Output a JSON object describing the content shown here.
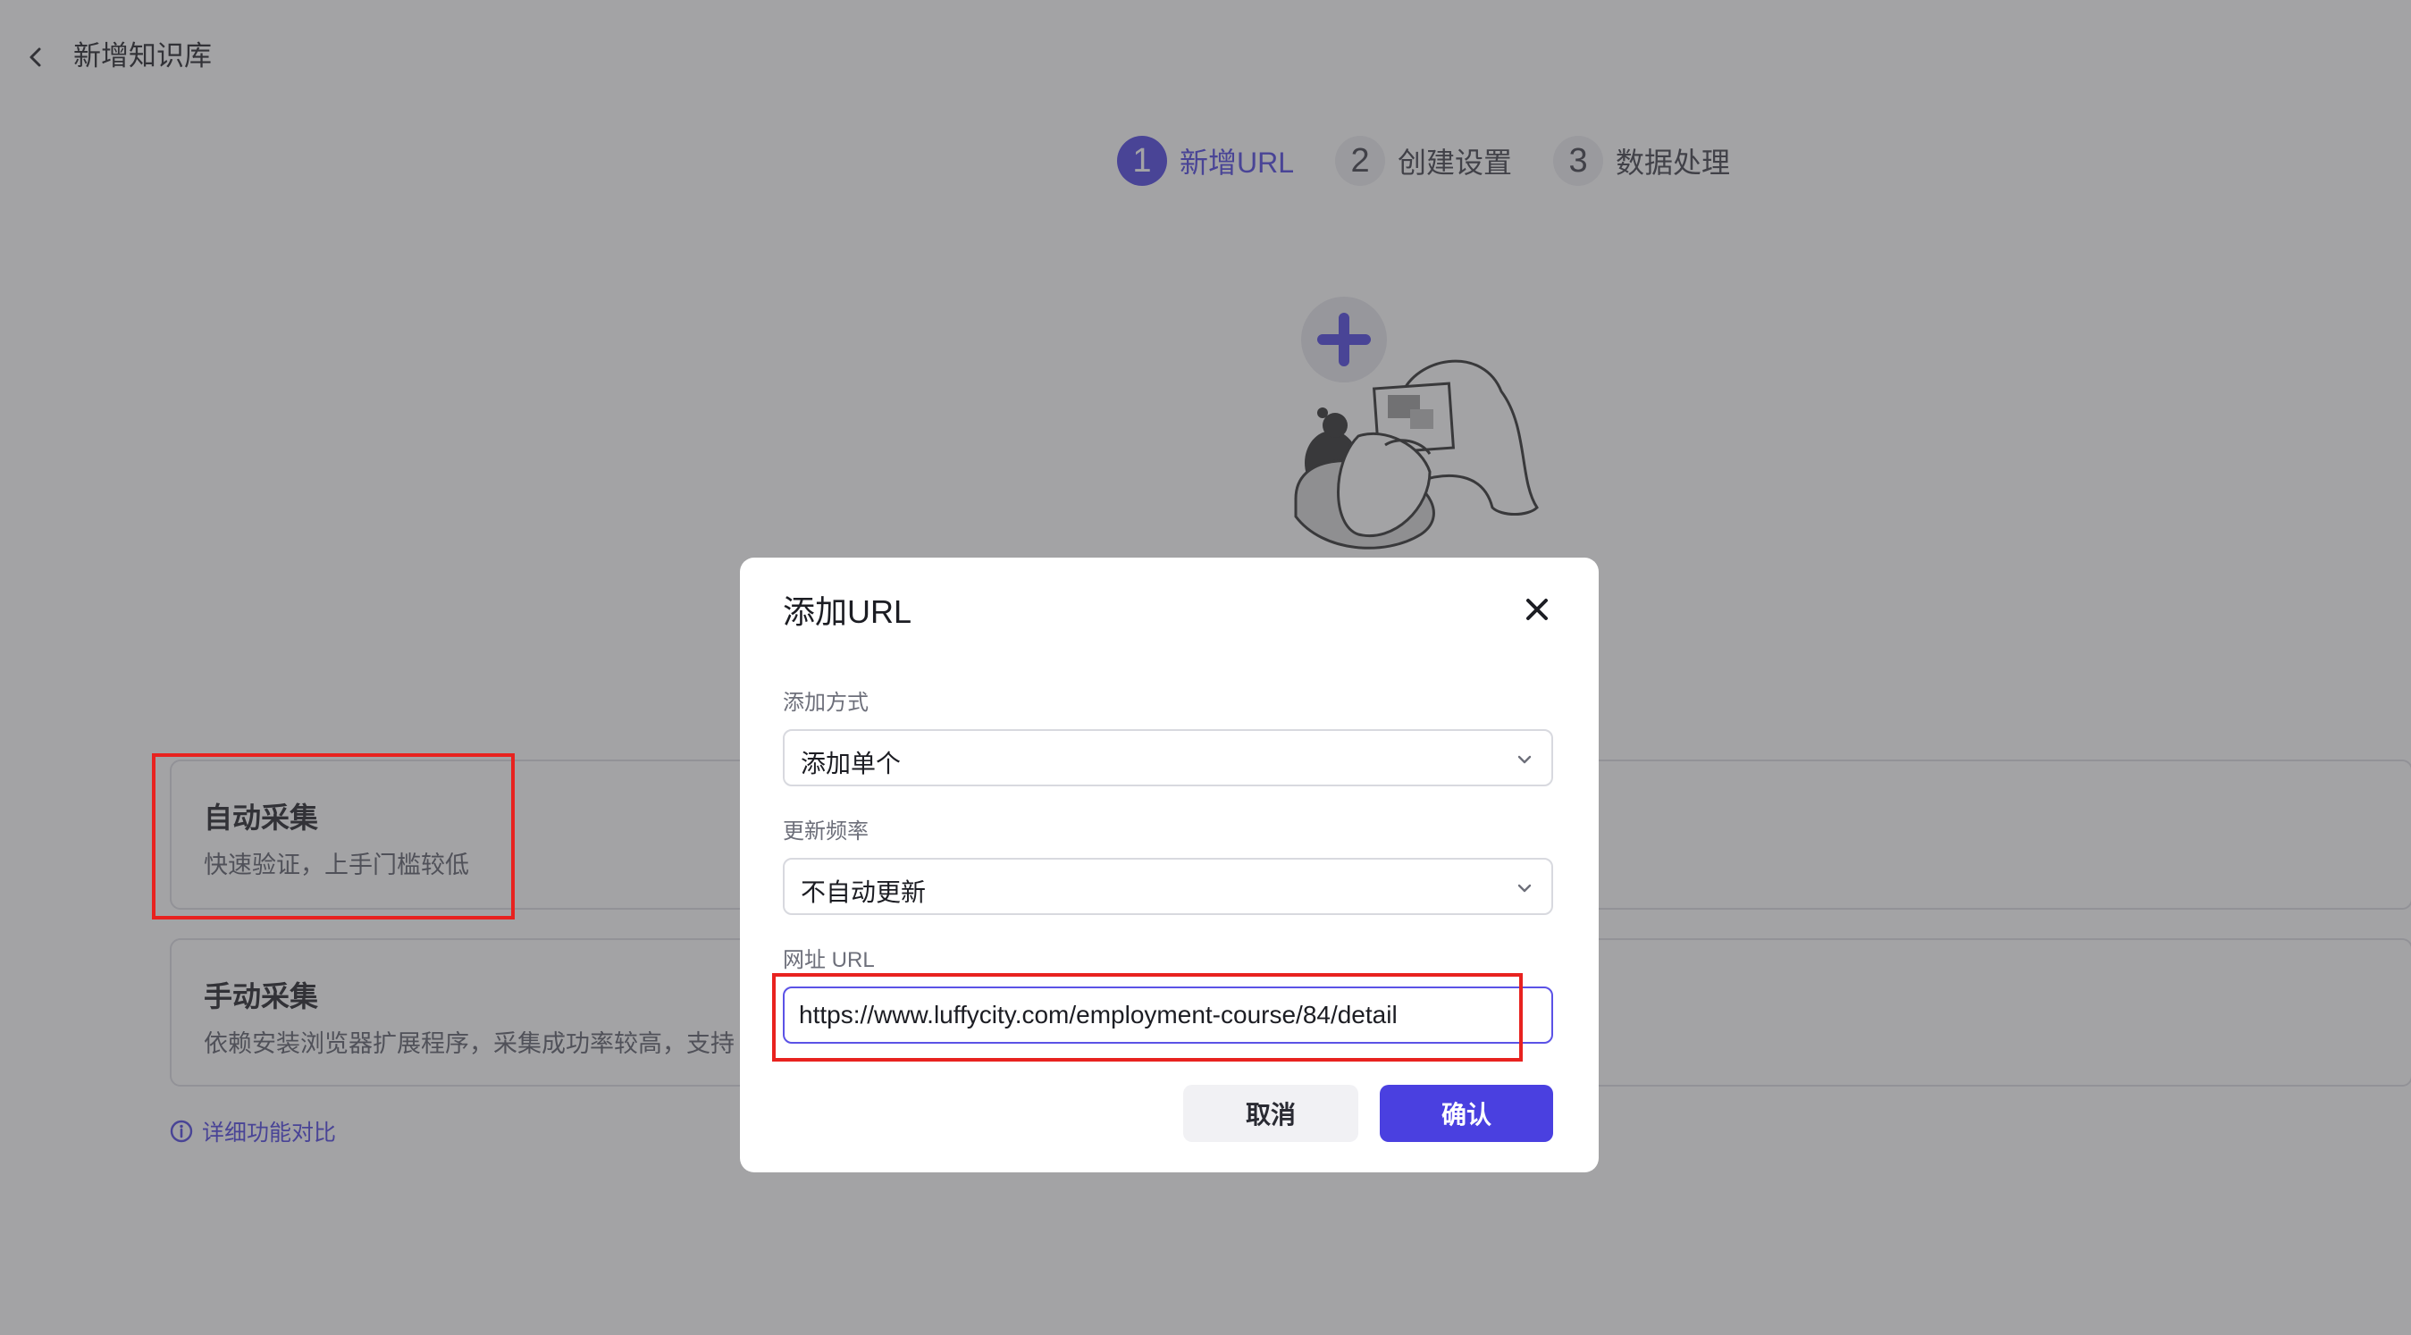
{
  "header": {
    "title": "新增知识库"
  },
  "steps": [
    {
      "num": "1",
      "label": "新增URL"
    },
    {
      "num": "2",
      "label": "创建设置"
    },
    {
      "num": "3",
      "label": "数据处理"
    }
  ],
  "options": {
    "auto": {
      "title": "自动采集",
      "desc": "快速验证，上手门槛较低"
    },
    "manual": {
      "title": "手动采集",
      "desc": "依赖安装浏览器扩展程序，采集成功率较高，支持"
    }
  },
  "compare_link": "详细功能对比",
  "dialog": {
    "title": "添加URL",
    "method_label": "添加方式",
    "method_value": "添加单个",
    "frequency_label": "更新频率",
    "frequency_value": "不自动更新",
    "url_label": "网址 URL",
    "url_value": "https://www.luffycity.com/employment-course/84/detail",
    "cancel": "取消",
    "confirm": "确认"
  },
  "colors": {
    "accent": "#4a40e0",
    "highlight": "#e8221f",
    "overlay": "rgba(72,72,76,0.5)"
  }
}
